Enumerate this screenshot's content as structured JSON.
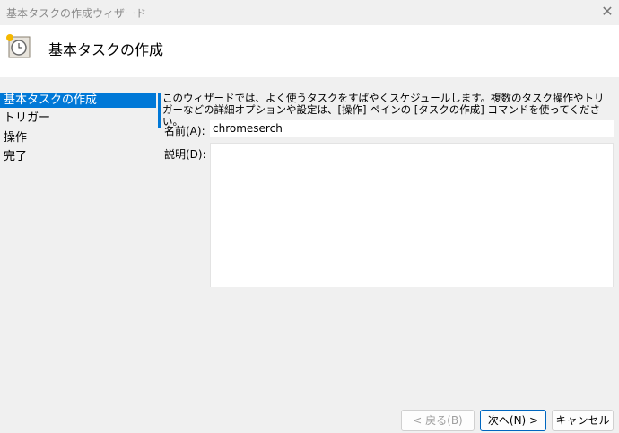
{
  "window": {
    "title": "基本タスクの作成ウィザード",
    "close": "✕"
  },
  "header": {
    "title": "基本タスクの作成"
  },
  "sidebar": {
    "items": [
      {
        "label": "基本タスクの作成",
        "selected": true
      },
      {
        "label": "トリガー"
      },
      {
        "label": "操作"
      },
      {
        "label": "完了"
      }
    ]
  },
  "main": {
    "intro": "このウィザードでは、よく使うタスクをすばやくスケジュールします。複数のタスク操作やトリガーなどの詳細オプションや設定は、[操作] ペインの [タスクの作成] コマンドを使ってください。",
    "name_label": "名前(A):",
    "name_value": "chromeserch",
    "desc_label": "説明(D):",
    "desc_value": ""
  },
  "buttons": {
    "back": "< 戻る(B)",
    "next": "次へ(N) >",
    "cancel": "キャンセル"
  },
  "colors": {
    "accent": "#0078d7"
  }
}
